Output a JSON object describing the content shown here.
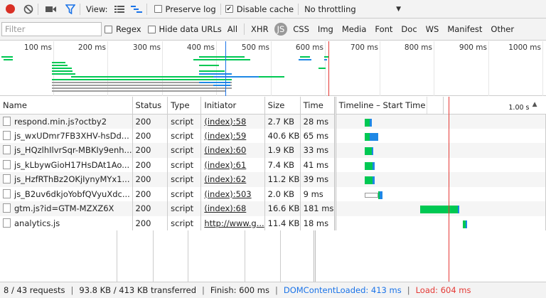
{
  "toolbar": {
    "view_label": "View:",
    "preserve_log": {
      "label": "Preserve log",
      "checked": false
    },
    "disable_cache": {
      "label": "Disable cache",
      "checked": true
    },
    "throttling": "No throttling"
  },
  "filterbar": {
    "placeholder": "Filter",
    "regex_label": "Regex",
    "hide_data_urls_label": "Hide data URLs",
    "types": [
      "All",
      "XHR",
      "JS",
      "CSS",
      "Img",
      "Media",
      "Font",
      "Doc",
      "WS",
      "Manifest",
      "Other"
    ],
    "active_type": "JS"
  },
  "overview": {
    "ticks": [
      "100 ms",
      "200 ms",
      "300 ms",
      "400 ms",
      "500 ms",
      "600 ms",
      "700 ms",
      "800 ms",
      "900 ms",
      "1000 ms"
    ]
  },
  "columns": {
    "name": "Name",
    "status": "Status",
    "type": "Type",
    "initiator": "Initiator",
    "size": "Size",
    "time": "Time",
    "timeline": "Timeline – Start Time",
    "timeline_scale": "1.00 s"
  },
  "rows": [
    {
      "name": "respond.min.js?octby2",
      "status": "200",
      "type": "script",
      "initiator": "(index):58",
      "size": "2.7 KB",
      "time": "28 ms"
    },
    {
      "name": "js_wxUDmr7FB3XHV-hsDd...",
      "status": "200",
      "type": "script",
      "initiator": "(index):59",
      "size": "40.6 KB",
      "time": "65 ms"
    },
    {
      "name": "js_HQzlhIlvrSqr-MBKIy9enh...",
      "status": "200",
      "type": "script",
      "initiator": "(index):60",
      "size": "1.9 KB",
      "time": "33 ms"
    },
    {
      "name": "js_kLbywGioH17HsDAt1Ao...",
      "status": "200",
      "type": "script",
      "initiator": "(index):61",
      "size": "7.4 KB",
      "time": "41 ms"
    },
    {
      "name": "js_HzfRThBz2OKjIynyMYx1...",
      "status": "200",
      "type": "script",
      "initiator": "(index):62",
      "size": "11.2 KB",
      "time": "39 ms"
    },
    {
      "name": "js_B2uv6dkjoYobfQVyuXdc...",
      "status": "200",
      "type": "script",
      "initiator": "(index):503",
      "size": "2.0 KB",
      "time": "9 ms"
    },
    {
      "name": "gtm.js?id=GTM-MZXZ6X",
      "status": "200",
      "type": "script",
      "initiator": "(index):68",
      "size": "16.6 KB",
      "time": "181 ms"
    },
    {
      "name": "analytics.js",
      "status": "200",
      "type": "script",
      "initiator": "http://www.g...",
      "size": "11.4 KB",
      "time": "18 ms"
    }
  ],
  "statusbar": {
    "requests": "8 / 43 requests",
    "transferred": "93.8 KB / 413 KB transferred",
    "finish": "Finish: 600 ms",
    "dom_content_loaded": "DOMContentLoaded: 413 ms",
    "load": "Load: 604 ms"
  },
  "colors": {
    "record": "#d93025",
    "filter_active": "#1a73e8",
    "waiting": "#00c853",
    "receiving": "#1e88e5",
    "dcl_line": "#1a73e8",
    "load_line": "#e53935"
  }
}
